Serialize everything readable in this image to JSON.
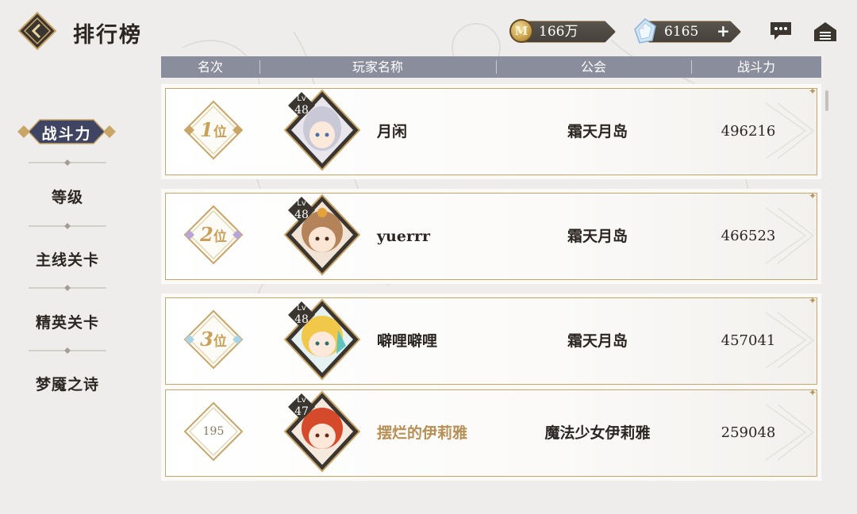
{
  "header": {
    "title": "排行榜",
    "coin_value": "166万",
    "gem_value": "6165",
    "plus_label": "+",
    "coin_symbol": "M"
  },
  "sidebar": {
    "active": "战斗力",
    "items": [
      "等级",
      "主线关卡",
      "精英关卡",
      "梦魇之诗"
    ]
  },
  "table": {
    "columns": [
      "名次",
      "玩家名称",
      "公会",
      "战斗力"
    ],
    "rows": [
      {
        "rank": "1",
        "rank_suffix": "位",
        "level_label": "Lv",
        "level": "48",
        "name": "月闲",
        "guild": "霜天月岛",
        "power": "496216"
      },
      {
        "rank": "2",
        "rank_suffix": "位",
        "level_label": "Lv",
        "level": "48",
        "name": "yuerrr",
        "guild": "霜天月岛",
        "power": "466523"
      },
      {
        "rank": "3",
        "rank_suffix": "位",
        "level_label": "Lv",
        "level": "48",
        "name": "噼哩噼哩",
        "guild": "霜天月岛",
        "power": "457041"
      },
      {
        "rank": "195",
        "rank_suffix": "",
        "level_label": "Lv",
        "level": "47",
        "name": "摆烂的伊莉雅",
        "guild": "魔法少女伊莉雅",
        "power": "259048"
      }
    ]
  },
  "colors": {
    "gold": "#c9a568",
    "header_bar": "#8a8e9c",
    "active_tab": "#3f4463",
    "self_name": "#b88f55"
  }
}
